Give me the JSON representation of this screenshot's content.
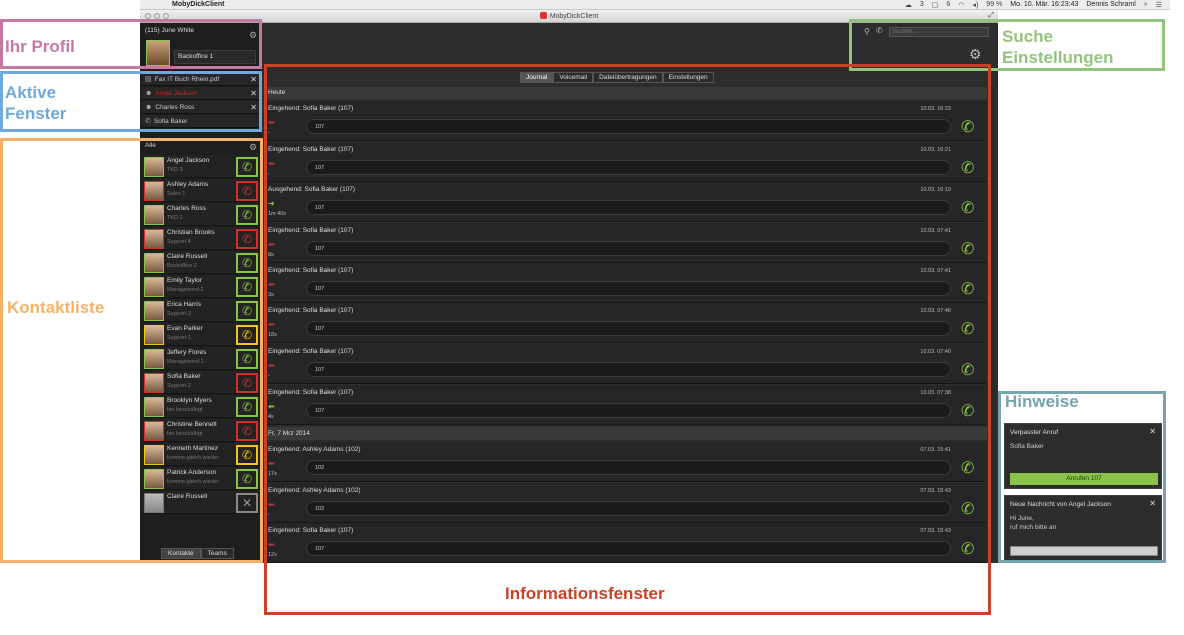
{
  "menubar": {
    "app_name": "MobyDickClient",
    "status_items": [
      "3",
      "6",
      "99 %"
    ],
    "datetime": "Mo. 10. Mär. 16:23:43",
    "user": "Dennis Schraml"
  },
  "window": {
    "title": "MobyDickClient"
  },
  "profile": {
    "header": "(115) June White",
    "status": "Backoffice 1"
  },
  "active_windows": [
    {
      "label": "Fax IT Buch Rhein.pdf",
      "icon": "fax-icon",
      "closable": true,
      "highlight": false
    },
    {
      "label": "Angel Jackson",
      "icon": "person-icon",
      "closable": true,
      "highlight": true
    },
    {
      "label": "Charles Ross",
      "icon": "person-icon",
      "closable": true,
      "highlight": false
    },
    {
      "label": "Sofia Baker",
      "icon": "phone-icon",
      "closable": false,
      "highlight": false
    }
  ],
  "contacts": {
    "filter_label": "Alle",
    "items": [
      {
        "name": "Angel Jackson",
        "sub": "TKD 3",
        "status": "green"
      },
      {
        "name": "Ashley Adams",
        "sub": "Sales 1",
        "status": "red"
      },
      {
        "name": "Charles Ross",
        "sub": "TKD 2",
        "status": "green"
      },
      {
        "name": "Christian Brooks",
        "sub": "Support 4",
        "status": "red"
      },
      {
        "name": "Claire Russell",
        "sub": "Backoffice 2",
        "status": "green"
      },
      {
        "name": "Emily Taylor",
        "sub": "Management 2",
        "status": "green"
      },
      {
        "name": "Erica Harris",
        "sub": "Support 3",
        "status": "green"
      },
      {
        "name": "Evan Parker",
        "sub": "Support 1",
        "status": "yellow"
      },
      {
        "name": "Jeffery Flores",
        "sub": "Management 1",
        "status": "green"
      },
      {
        "name": "Sofia Baker",
        "sub": "Support 2",
        "status": "red"
      },
      {
        "name": "Brooklyn Myers",
        "sub": "bin beschäftigt",
        "status": "green"
      },
      {
        "name": "Christine Bennett",
        "sub": "bin beschäftigt",
        "status": "red"
      },
      {
        "name": "Kenneth Martinez",
        "sub": "komme gleich wieder",
        "status": "yellow"
      },
      {
        "name": "Patrick Anderson",
        "sub": "komme gleich wieder",
        "status": "green"
      },
      {
        "name": "Claire Russell",
        "sub": "",
        "status": "grey"
      }
    ],
    "tabs": [
      "Kontakte",
      "Teams"
    ]
  },
  "search": {
    "placeholder": "Suchen..."
  },
  "main_tabs": [
    "Journal",
    "Voicemail",
    "Dateiübertragungen",
    "Einstellungen"
  ],
  "journal": {
    "groups": [
      {
        "label": "Heute",
        "entries": [
          {
            "title": "Eingehend: Sofia Baker (107)",
            "time": "10.03. 16:23",
            "number": "107",
            "direction": "in",
            "duration": "-"
          },
          {
            "title": "Eingehend: Sofia Baker (107)",
            "time": "10.03. 16:21",
            "number": "107",
            "direction": "in",
            "duration": "-"
          },
          {
            "title": "Ausgehend: Sofia Baker (107)",
            "time": "10.03. 16:19",
            "number": "107",
            "direction": "out",
            "duration": "1m 40s"
          },
          {
            "title": "Eingehend: Sofia Baker (107)",
            "time": "10.03. 07:41",
            "number": "107",
            "direction": "in",
            "duration": "8s"
          },
          {
            "title": "Eingehend: Sofia Baker (107)",
            "time": "10.03. 07:41",
            "number": "107",
            "direction": "in",
            "duration": "3s"
          },
          {
            "title": "Eingehend: Sofia Baker (107)",
            "time": "10.03. 07:40",
            "number": "107",
            "direction": "in",
            "duration": "18s"
          },
          {
            "title": "Eingehend: Sofia Baker (107)",
            "time": "10.03. 07:40",
            "number": "107",
            "direction": "in",
            "duration": "-"
          },
          {
            "title": "Eingehend: Sofia Baker (107)",
            "time": "10.03. 07:38",
            "number": "107",
            "direction": "in-ok",
            "duration": "4s"
          }
        ]
      },
      {
        "label": "Fr, 7 Mrz 2014",
        "entries": [
          {
            "title": "Eingehend: Ashley Adams (102)",
            "time": "07.03. 15:41",
            "number": "102",
            "direction": "in",
            "duration": "17s"
          },
          {
            "title": "Eingehend: Ashley Adams (102)",
            "time": "07.03. 15:43",
            "number": "102",
            "direction": "in",
            "duration": "-"
          },
          {
            "title": "Eingehend: Sofia Baker (107)",
            "time": "07.03. 15:43",
            "number": "107",
            "direction": "in",
            "duration": "12s"
          }
        ]
      }
    ]
  },
  "notifications": [
    {
      "title": "Verpasster Anruf",
      "body": "Sofia Baker",
      "button": "Anrufen 107"
    },
    {
      "title": "Neue Nachricht von Angel Jackson",
      "body_lines": [
        "Hi June,",
        "ruf mich bitte an"
      ]
    }
  ],
  "annotations": {
    "profile": "Ihr Profil",
    "active": [
      "Aktive",
      "Fenster"
    ],
    "contacts": "Kontaktliste",
    "search": [
      "Suche",
      "Einstellungen"
    ],
    "info": "Informationsfenster",
    "hints": "Hinweise"
  },
  "colors": {
    "profile": "#c678a4",
    "active": "#6fa8dc",
    "contacts": "#f6b26b",
    "search": "#93c47d",
    "info": "#cc4125",
    "hints": "#76a5af",
    "status_green": "#8bc34a",
    "status_red": "#d32f2f",
    "status_yellow": "#f5c518"
  }
}
